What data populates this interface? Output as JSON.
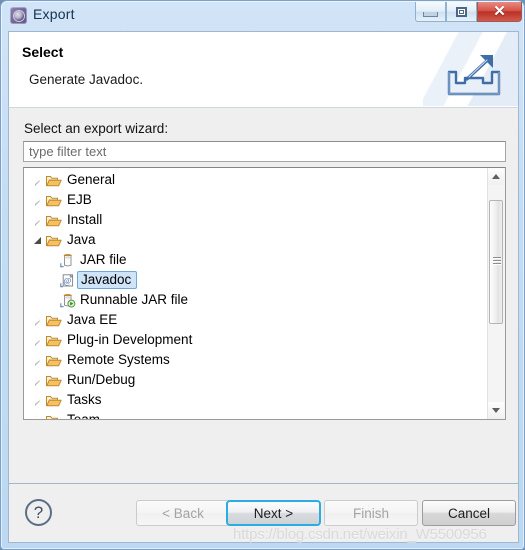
{
  "window": {
    "title": "Export",
    "icon": "export-wizard-icon",
    "controls": {
      "minimize": "Minimize",
      "maximize": "Maximize",
      "close": "Close",
      "close_glyph": "✕"
    }
  },
  "header": {
    "title": "Select",
    "description": "Generate Javadoc.",
    "banner_icon": "export-arrow-icon"
  },
  "body": {
    "wizard_label": "Select an export wizard:",
    "filter": {
      "value": "",
      "placeholder": "type filter text"
    },
    "tree": {
      "nodes": [
        {
          "label": "General",
          "type": "folder",
          "state": "collapsed",
          "depth": 0,
          "selected": false
        },
        {
          "label": "EJB",
          "type": "folder",
          "state": "collapsed",
          "depth": 0,
          "selected": false
        },
        {
          "label": "Install",
          "type": "folder",
          "state": "collapsed",
          "depth": 0,
          "selected": false
        },
        {
          "label": "Java",
          "type": "folder",
          "state": "expanded",
          "depth": 0,
          "selected": false
        },
        {
          "label": "JAR file",
          "type": "jar",
          "state": "leaf",
          "depth": 1,
          "selected": false
        },
        {
          "label": "Javadoc",
          "type": "javadoc",
          "state": "leaf",
          "depth": 1,
          "selected": true
        },
        {
          "label": "Runnable JAR file",
          "type": "runnable-jar",
          "state": "leaf",
          "depth": 1,
          "selected": false
        },
        {
          "label": "Java EE",
          "type": "folder",
          "state": "collapsed",
          "depth": 0,
          "selected": false
        },
        {
          "label": "Plug-in Development",
          "type": "folder",
          "state": "collapsed",
          "depth": 0,
          "selected": false
        },
        {
          "label": "Remote Systems",
          "type": "folder",
          "state": "collapsed",
          "depth": 0,
          "selected": false
        },
        {
          "label": "Run/Debug",
          "type": "folder",
          "state": "collapsed",
          "depth": 0,
          "selected": false
        },
        {
          "label": "Tasks",
          "type": "folder",
          "state": "collapsed",
          "depth": 0,
          "selected": false
        },
        {
          "label": "Team",
          "type": "folder",
          "state": "collapsed",
          "depth": 0,
          "selected": false
        }
      ],
      "scrollbar": {
        "up_glyph": "▲",
        "down_glyph": "▼",
        "thumb_top_pct": 7,
        "thumb_height_pct": 57
      }
    }
  },
  "footer": {
    "help_glyph": "?",
    "buttons": {
      "back": {
        "label": "< Back",
        "enabled": false,
        "focused": false
      },
      "next": {
        "label": "Next >",
        "enabled": true,
        "focused": true
      },
      "finish": {
        "label": "Finish",
        "enabled": false,
        "focused": false
      },
      "cancel": {
        "label": "Cancel",
        "enabled": true,
        "focused": false
      }
    }
  },
  "watermark": "https://blog.csdn.net/weixin_W5500956",
  "colors": {
    "titlebar": "#c5ddf5",
    "accent_focus": "#2cace3",
    "selection_fill": "#cfe4f7",
    "selection_border": "#6fa8d8",
    "folder": "#e8a33d",
    "body_bg": "#efefef",
    "close_button": "#c03a2b"
  }
}
